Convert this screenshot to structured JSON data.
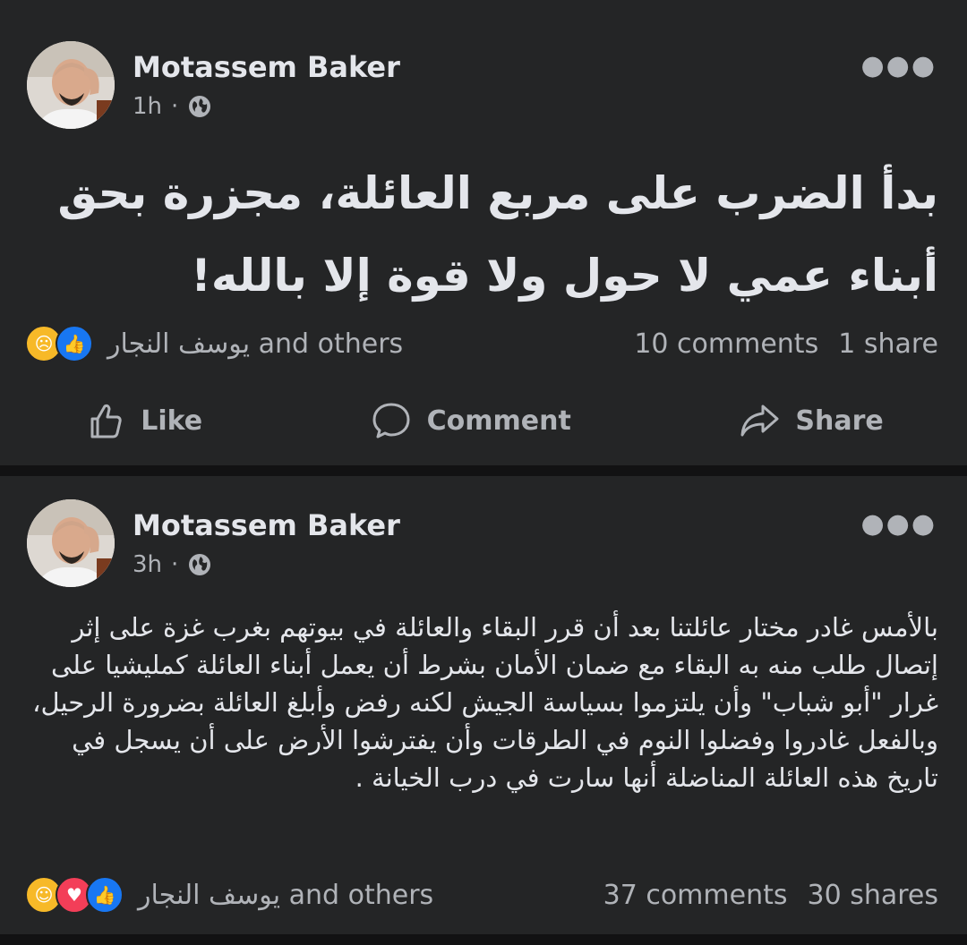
{
  "posts": [
    {
      "author": "Motassem Baker",
      "time": "1h",
      "dot": "·",
      "text": "بدأ الضرب على مربع العائلة، مجزرة بحق أبناء عمي لا حول ولا قوة إلا بالله!",
      "reactions": [
        "sad",
        "like"
      ],
      "reactors": "يوسف النجار and others",
      "comments": "10 comments",
      "shares": "1 share",
      "actions": {
        "like": "Like",
        "comment": "Comment",
        "share": "Share"
      }
    },
    {
      "author": "Motassem Baker",
      "time": "3h",
      "dot": "·",
      "text": "بالأمس غادر مختار عائلتنا بعد أن قرر البقاء والعائلة في بيوتهم بغرب غزة على إثر إتصال طلب منه به البقاء مع ضمان الأمان بشرط أن يعمل أبناء العائلة كمليشيا على غرار \"أبو شباب\" وأن يلتزموا بسياسة الجيش لكنه رفض وأبلغ العائلة بضرورة الرحيل، وبالفعل غادروا وفضلوا النوم في الطرقات وأن يفترشوا الأرض على أن يسجل في تاريخ هذه العائلة المناضلة أنها سارت في درب الخيانة .",
      "reactions": [
        "care",
        "love",
        "like"
      ],
      "reactors": "يوسف النجار and others",
      "comments": "37 comments",
      "shares": "30 shares"
    }
  ],
  "colors": {
    "background": "#121213",
    "card": "#242526",
    "text": "#e4e6eb",
    "muted": "#b0b3b8",
    "like_blue": "#1877f2",
    "love_red": "#f33e58",
    "emoji_yellow": "#f7b928"
  },
  "icons": [
    "more-options-icon",
    "globe-icon",
    "like-icon",
    "comment-icon",
    "share-icon"
  ]
}
